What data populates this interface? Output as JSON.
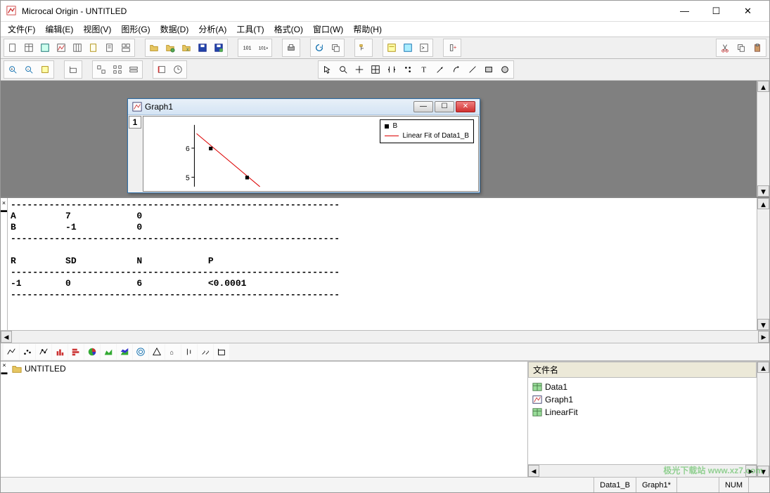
{
  "window": {
    "title": "Microcal Origin - UNTITLED"
  },
  "menu": [
    "文件(F)",
    "编辑(E)",
    "视图(V)",
    "图形(G)",
    "数据(D)",
    "分析(A)",
    "工具(T)",
    "格式(O)",
    "窗口(W)",
    "帮助(H)"
  ],
  "graphWindow": {
    "title": "Graph1",
    "tab": "1",
    "legend": {
      "series1": "B",
      "series2": "Linear Fit of Data1_B"
    },
    "yticks": [
      "6",
      "5"
    ]
  },
  "results": {
    "text": "------------------------------------------------------------\nA         7            0\nB         -1           0\n------------------------------------------------------------\n\nR         SD           N            P\n------------------------------------------------------------\n-1        0            6            <0.0001\n------------------------------------------------------------"
  },
  "project": {
    "root": "UNTITLED",
    "filesHeader": "文件名",
    "files": [
      "Data1",
      "Graph1",
      "LinearFit"
    ]
  },
  "status": {
    "data": "Data1_B",
    "graph": "Graph1*",
    "num": "NUM"
  },
  "watermark": "极光下载站 www.xz7.com",
  "chart_data": {
    "type": "scatter+line",
    "title": "",
    "x_range": [
      1,
      6
    ],
    "y_visible_range": [
      5,
      6.5
    ],
    "yticks": [
      5,
      6
    ],
    "series": [
      {
        "name": "B",
        "type": "scatter",
        "x": [
          1.1,
          2.1
        ],
        "y": [
          6.0,
          5.0
        ],
        "marker": "square",
        "color": "#000000"
      },
      {
        "name": "Linear Fit of Data1_B",
        "type": "line",
        "slope": -1,
        "intercept": 7,
        "color": "#d00000"
      }
    ],
    "fit_parameters": {
      "A": 7,
      "A_err": 0,
      "B": -1,
      "B_err": 0,
      "R": -1,
      "SD": 0,
      "N": 6,
      "P": "<0.0001"
    }
  }
}
